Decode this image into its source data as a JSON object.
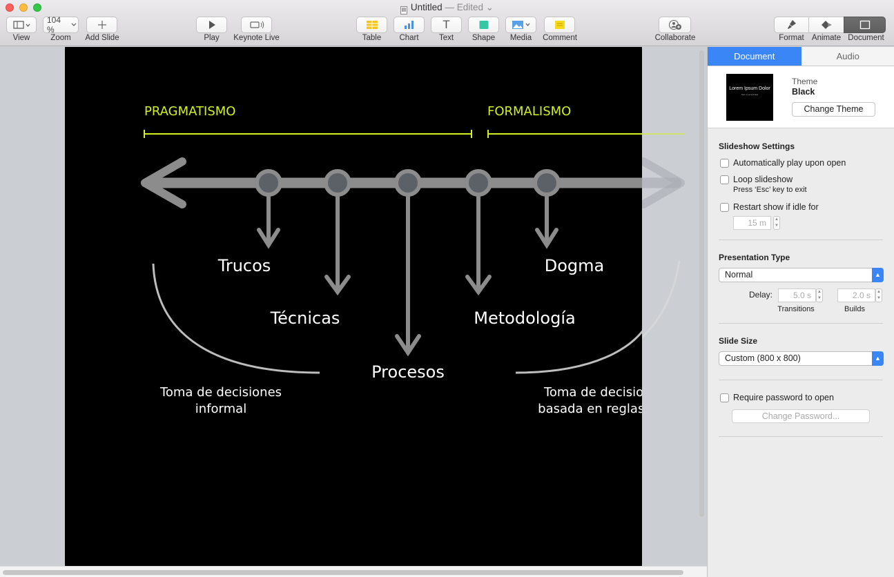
{
  "window": {
    "title": "Untitled",
    "status": "— Edited"
  },
  "toolbar": {
    "view": {
      "label": "View",
      "icon": "sidebar-layout-icon"
    },
    "zoom": {
      "label": "Zoom",
      "value": "104 %"
    },
    "add_slide": {
      "label": "Add Slide",
      "icon": "plus-icon"
    },
    "play": {
      "label": "Play",
      "icon": "play-icon"
    },
    "keynote_live": {
      "label": "Keynote Live",
      "icon": "broadcast-icon"
    },
    "table": {
      "label": "Table",
      "icon": "table-icon"
    },
    "chart": {
      "label": "Chart",
      "icon": "bar-chart-icon"
    },
    "text": {
      "label": "Text",
      "icon": "text-icon",
      "glyph": "T"
    },
    "shape": {
      "label": "Shape",
      "icon": "square-shape-icon"
    },
    "media": {
      "label": "Media",
      "icon": "image-icon"
    },
    "comment": {
      "label": "Comment",
      "icon": "comment-icon"
    },
    "collaborate": {
      "label": "Collaborate",
      "icon": "add-person-icon"
    },
    "format": {
      "label": "Format",
      "icon": "paintbrush-icon"
    },
    "animate": {
      "label": "Animate",
      "icon": "diamond-icon"
    },
    "document": {
      "label": "Document",
      "icon": "document-icon"
    }
  },
  "slide": {
    "heading_left": "PRAGMATISMO",
    "heading_right": "FORMALISMO",
    "items": {
      "trucos": "Trucos",
      "tecnicas": "Técnicas",
      "procesos": "Procesos",
      "metodologia": "Metodología",
      "dogma": "Dogma"
    },
    "caption_left_line1": "Toma de decisiones",
    "caption_left_line2": "informal",
    "caption_right_line1": "Toma de decisiones",
    "caption_right_line2": "basada en reglas y fe",
    "colors": {
      "accent": "#d4ef1f",
      "arrow": "#8c8c8c",
      "dot": "#5c6168",
      "text": "#ffffff",
      "curve": "#bdbdbd"
    }
  },
  "inspector": {
    "tabs": [
      "Document",
      "Audio"
    ],
    "theme": {
      "label": "Theme",
      "name": "Black",
      "change_button": "Change Theme",
      "thumbnail_title": "Lorem Ipsum Dolor",
      "thumbnail_subtitle": "Sed ut perspiciatis"
    },
    "slideshow": {
      "heading": "Slideshow Settings",
      "auto_play": "Automatically play upon open",
      "loop": "Loop slideshow",
      "loop_hint": "Press ‘Esc’ key to exit",
      "restart": "Restart show if idle for",
      "idle_value": "15 m"
    },
    "presentation": {
      "heading": "Presentation Type",
      "type_value": "Normal",
      "delay_label": "Delay:",
      "transitions_value": "5.0 s",
      "builds_value": "2.0 s",
      "transitions_label": "Transitions",
      "builds_label": "Builds"
    },
    "slide_size": {
      "heading": "Slide Size",
      "value": "Custom (800 x 800)"
    },
    "password": {
      "require": "Require password to open",
      "change_button": "Change Password..."
    }
  }
}
